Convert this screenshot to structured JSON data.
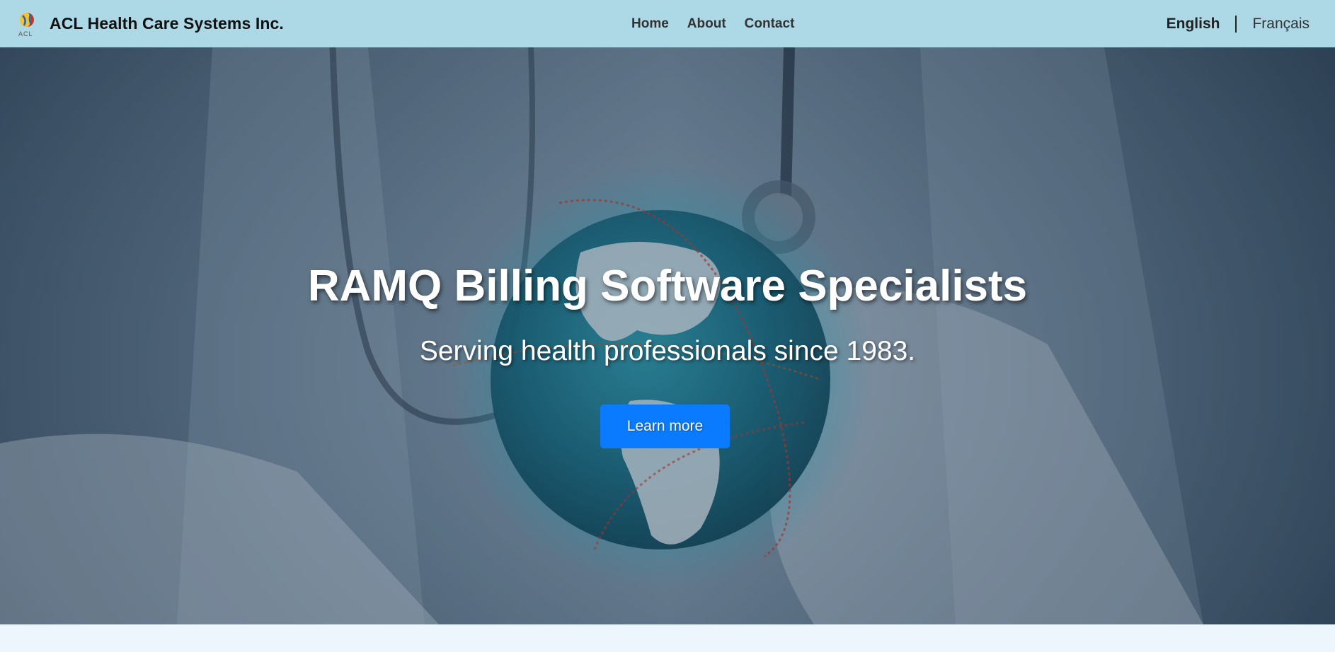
{
  "header": {
    "brand_name": "ACL Health Care Systems Inc.",
    "logo_text": "ACL",
    "nav": [
      {
        "label": "Home"
      },
      {
        "label": "About"
      },
      {
        "label": "Contact"
      }
    ],
    "languages": [
      {
        "label": "English",
        "active": true
      },
      {
        "label": "Français",
        "active": false
      }
    ]
  },
  "hero": {
    "title": "RAMQ Billing Software Specialists",
    "subtitle": "Serving health professionals since 1983.",
    "cta_label": "Learn more"
  },
  "colors": {
    "navbar_bg": "#add8e6",
    "cta_bg": "#0a7bff",
    "page_bg": "#eef6fd"
  },
  "icons": {
    "logo": "acl-globe-logo"
  }
}
